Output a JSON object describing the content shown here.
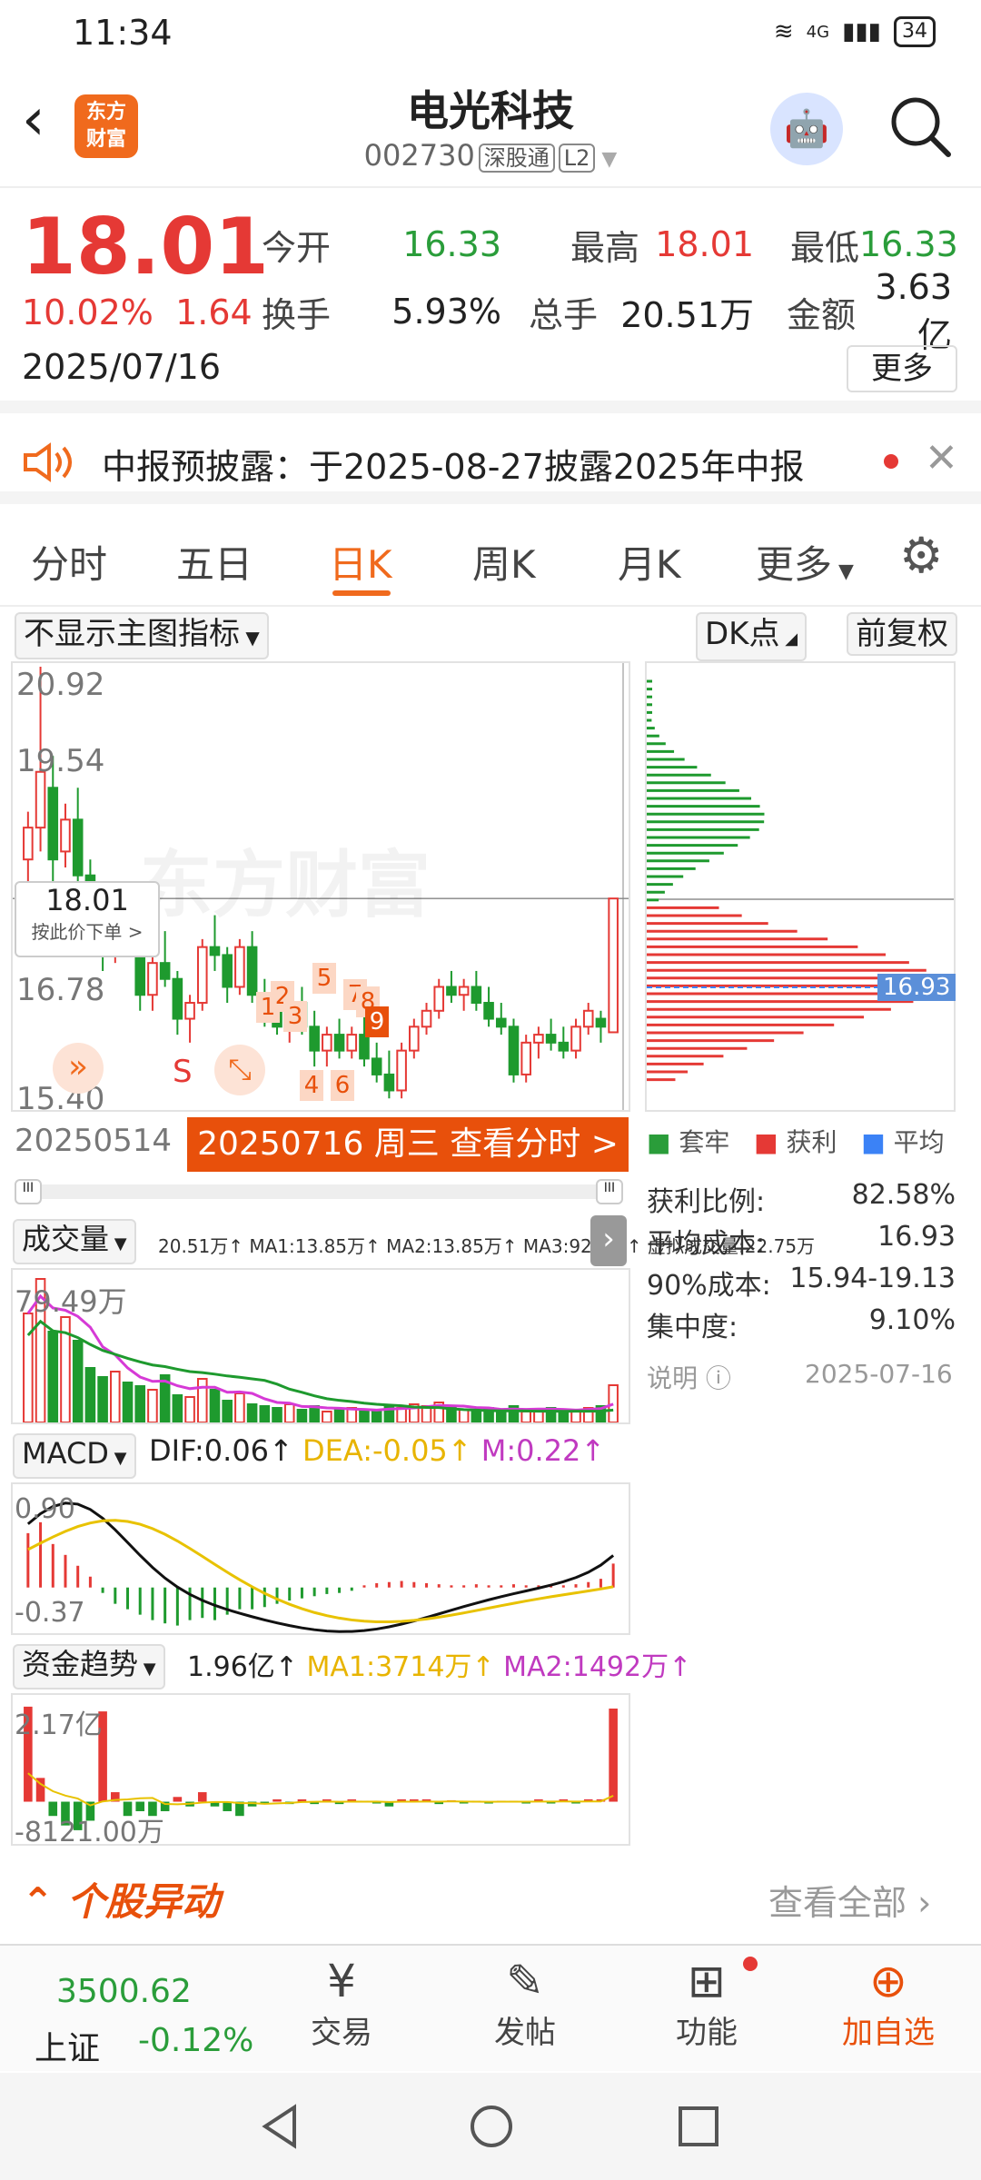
{
  "status": {
    "time": "11:34",
    "battery": "34",
    "net": "4G"
  },
  "header": {
    "name": "电光科技",
    "code": "002730",
    "tag1": "深股通",
    "tag2": "L2",
    "logo_line1": "东方",
    "logo_line2": "财富"
  },
  "quote": {
    "price": "18.01",
    "pct": "10.02%",
    "change": "1.64",
    "date": "2025/07/16",
    "open_label": "今开",
    "open": "16.33",
    "high_label": "最高",
    "high": "18.01",
    "low_label": "最低",
    "low": "16.33",
    "turn_label": "换手",
    "turn": "5.93%",
    "vol_label": "总手",
    "vol": "20.51万",
    "amt_label": "金额",
    "amt": "3.63亿",
    "more": "更多"
  },
  "notice": {
    "text": "中报预披露：于2025-08-27披露2025年中报"
  },
  "tabs": [
    "分时",
    "五日",
    "日K",
    "周K",
    "月K",
    "更多"
  ],
  "kchart": {
    "indicator": "不显示主图指标",
    "dk": "DK点",
    "adjust": "前复权",
    "y_labels": [
      "20.92",
      "19.54",
      "16.78",
      "15.40"
    ],
    "price_tag": "18.01",
    "price_tag_sub": "按此价下单 >",
    "start_date": "20250514",
    "date_bar": "20250716 周三 查看分时 >",
    "s_mark": "S",
    "watermark": "东方财富",
    "marks": [
      "1",
      "2",
      "3",
      "4",
      "5",
      "6",
      "7",
      "8",
      "9"
    ],
    "avg_tag": "16.93"
  },
  "chips": {
    "legend": [
      "套牢",
      "获利",
      "平均"
    ],
    "rows": [
      {
        "k": "获利比例:",
        "v": "82.58%"
      },
      {
        "k": "平均成本:",
        "v": "16.93"
      },
      {
        "k": "90%成本:",
        "v": "15.94-19.13"
      },
      {
        "k": "集中度:",
        "v": "9.10%"
      }
    ],
    "note": "说明",
    "note_date": "2025-07-16"
  },
  "volume": {
    "title": "成交量",
    "legend": "20.51万↑ MA1:13.85万↑ MA2:13.85万↑ MA3:92482↑ 虚拟成交量:22.75万",
    "ymax": "79.49万"
  },
  "macd": {
    "title": "MACD",
    "dif": "DIF:0.06↑",
    "dea": "DEA:-0.05↑",
    "m": "M:0.22↑",
    "ymax": "0.90",
    "ymin": "-0.37"
  },
  "fund": {
    "title": "资金趋势",
    "val": "1.96亿↑",
    "ma1": "MA1:3714万↑",
    "ma2": "MA2:1492万↑",
    "ymax": "2.17亿",
    "ymin": "-8121.00万"
  },
  "abnormal": {
    "title": "个股异动",
    "all": "查看全部"
  },
  "bottom": {
    "index_val": "3500.62",
    "index_name": "上证",
    "index_chg": "-0.12%",
    "items": [
      "交易",
      "发帖",
      "功能",
      "加自选"
    ]
  },
  "chart_data": {
    "type": "candlestick",
    "categories_start": "20250514",
    "categories_end": "20250716",
    "ylim": [
      15.4,
      20.92
    ],
    "candles": [
      [
        18.5,
        19.1,
        18.2,
        18.9
      ],
      [
        18.9,
        20.92,
        18.6,
        19.6
      ],
      [
        19.4,
        19.8,
        18.2,
        18.5
      ],
      [
        18.6,
        19.2,
        18.4,
        19.0
      ],
      [
        19.0,
        19.4,
        18.1,
        18.3
      ],
      [
        18.3,
        18.5,
        17.4,
        17.6
      ],
      [
        17.6,
        17.9,
        17.1,
        17.3
      ],
      [
        17.3,
        17.8,
        17.2,
        17.7
      ],
      [
        17.7,
        17.9,
        17.3,
        17.5
      ],
      [
        17.5,
        17.6,
        16.6,
        16.8
      ],
      [
        16.8,
        17.3,
        16.6,
        17.2
      ],
      [
        17.2,
        17.6,
        16.9,
        17.0
      ],
      [
        17.0,
        17.1,
        16.3,
        16.5
      ],
      [
        16.5,
        16.8,
        16.2,
        16.7
      ],
      [
        16.7,
        17.5,
        16.6,
        17.4
      ],
      [
        17.4,
        17.8,
        17.1,
        17.3
      ],
      [
        17.3,
        17.4,
        16.7,
        16.9
      ],
      [
        16.9,
        17.5,
        16.8,
        17.4
      ],
      [
        17.4,
        17.6,
        16.7,
        16.8
      ],
      [
        16.8,
        17.0,
        16.4,
        16.6
      ],
      [
        16.6,
        16.9,
        16.3,
        16.4
      ],
      [
        16.4,
        16.8,
        16.2,
        16.7
      ],
      [
        16.7,
        16.9,
        16.3,
        16.4
      ],
      [
        16.4,
        16.6,
        15.9,
        16.1
      ],
      [
        16.1,
        16.4,
        15.9,
        16.3
      ],
      [
        16.3,
        16.5,
        16.0,
        16.1
      ],
      [
        16.1,
        16.4,
        16.0,
        16.3
      ],
      [
        16.3,
        16.6,
        15.9,
        16.0
      ],
      [
        16.0,
        16.2,
        15.7,
        15.8
      ],
      [
        15.8,
        16.1,
        15.5,
        15.6
      ],
      [
        15.6,
        16.2,
        15.5,
        16.1
      ],
      [
        16.1,
        16.5,
        16.0,
        16.4
      ],
      [
        16.4,
        16.7,
        16.3,
        16.6
      ],
      [
        16.6,
        17.0,
        16.5,
        16.9
      ],
      [
        16.9,
        17.1,
        16.7,
        16.8
      ],
      [
        16.8,
        17.0,
        16.6,
        16.9
      ],
      [
        16.9,
        17.1,
        16.6,
        16.7
      ],
      [
        16.7,
        16.9,
        16.4,
        16.5
      ],
      [
        16.5,
        16.7,
        16.3,
        16.4
      ],
      [
        16.4,
        16.5,
        15.7,
        15.8
      ],
      [
        15.8,
        16.3,
        15.7,
        16.2
      ],
      [
        16.2,
        16.4,
        16.0,
        16.3
      ],
      [
        16.3,
        16.5,
        16.1,
        16.2
      ],
      [
        16.2,
        16.4,
        16.0,
        16.1
      ],
      [
        16.1,
        16.5,
        16.0,
        16.4
      ],
      [
        16.4,
        16.7,
        16.3,
        16.6
      ],
      [
        16.5,
        16.6,
        16.2,
        16.4
      ],
      [
        16.33,
        18.01,
        16.33,
        18.01
      ]
    ],
    "volume": [
      60,
      79,
      50,
      58,
      45,
      30,
      25,
      28,
      22,
      20,
      18,
      26,
      15,
      14,
      24,
      18,
      12,
      16,
      10,
      9,
      8,
      10,
      7,
      9,
      6,
      7,
      8,
      6,
      7,
      9,
      8,
      10,
      9,
      11,
      8,
      7,
      6,
      8,
      7,
      9,
      6,
      7,
      8,
      6,
      7,
      8,
      9,
      20.5
    ],
    "macd_hist": [
      0.5,
      0.6,
      0.4,
      0.3,
      0.2,
      0.1,
      -0.05,
      -0.15,
      -0.2,
      -0.25,
      -0.3,
      -0.33,
      -0.35,
      -0.3,
      -0.28,
      -0.3,
      -0.25,
      -0.2,
      -0.2,
      -0.18,
      -0.15,
      -0.12,
      -0.1,
      -0.08,
      -0.06,
      -0.05,
      -0.03,
      0.02,
      0.04,
      0.05,
      0.06,
      0.05,
      0.04,
      0.03,
      0.02,
      0.02,
      0.03,
      0.02,
      0.02,
      0.03,
      0.02,
      0.02,
      0.03,
      0.02,
      0.03,
      0.05,
      0.08,
      0.22
    ],
    "fund": [
      2.0,
      0.5,
      -0.3,
      -0.5,
      -0.6,
      -0.4,
      1.9,
      0.2,
      -0.3,
      -0.2,
      -0.3,
      -0.2,
      0.1,
      -0.1,
      0.2,
      -0.1,
      -0.2,
      -0.3,
      -0.1,
      -0.05,
      0.05,
      -0.05,
      0.05,
      -0.05,
      0.05,
      -0.05,
      0.05,
      0.02,
      -0.02,
      -0.1,
      0.05,
      0.05,
      0.05,
      -0.05,
      0.03,
      -0.03,
      0.02,
      -0.02,
      0.02,
      0.02,
      -0.02,
      0.05,
      -0.03,
      0.05,
      -0.02,
      0.05,
      0.05,
      1.96
    ]
  }
}
